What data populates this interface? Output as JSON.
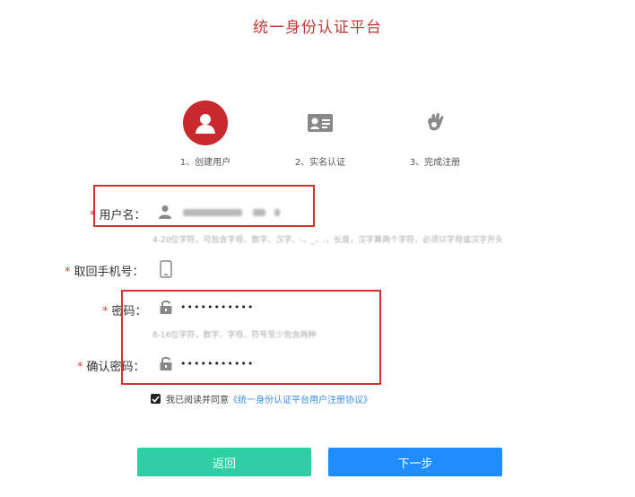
{
  "header": {
    "title": "统一身份认证平台"
  },
  "steps": [
    {
      "label": "1、创建用户",
      "icon": "user-icon",
      "active": true
    },
    {
      "label": "2、实名认证",
      "icon": "id-card-icon",
      "active": false
    },
    {
      "label": "3、完成注册",
      "icon": "hand-ok-icon",
      "active": false
    }
  ],
  "form": {
    "username": {
      "required_mark": "*",
      "label": "用户名：",
      "icon": "user-icon"
    },
    "username_hint": "4-20位字符，可包含字母、数字、汉字、-、_、.，长度，汉字算两个字符，必须以字母或汉字开头",
    "phone": {
      "required_mark": "*",
      "label": "取回手机号：",
      "icon": "phone-icon"
    },
    "password": {
      "required_mark": "*",
      "label": "密码：",
      "icon": "lock-icon",
      "value": "•••••••••••"
    },
    "password_hint": "8-16位字符，数字、字母、符号至少包含两种",
    "confirm_password": {
      "required_mark": "*",
      "label": "确认密码：",
      "icon": "lock-icon",
      "value": "•••••••••••"
    },
    "agreement": {
      "prefix": "我已阅读并同意",
      "link": "《统一身份认证平台用户注册协议》",
      "checked": true
    }
  },
  "buttons": {
    "back": "返回",
    "next": "下一步"
  },
  "colors": {
    "brand_red": "#c8292d",
    "back_green": "#2ecfa4",
    "next_blue": "#1f8cff"
  }
}
